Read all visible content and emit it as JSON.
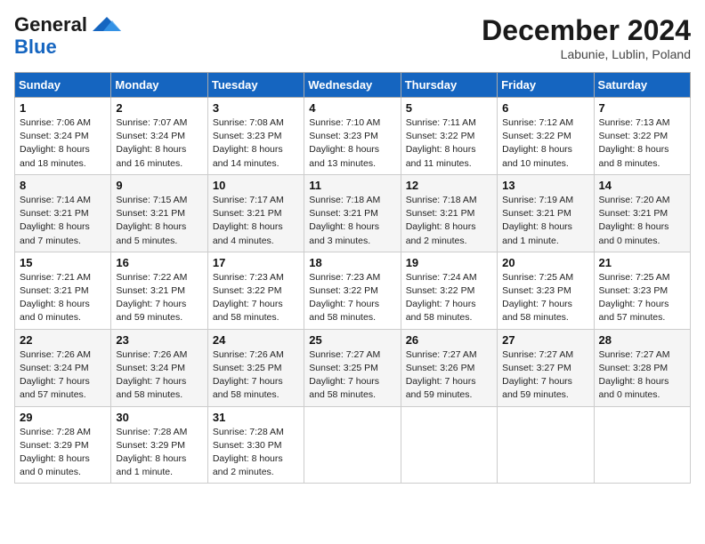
{
  "header": {
    "logo_line1": "General",
    "logo_line2": "Blue",
    "month_title": "December 2024",
    "location": "Labunie, Lublin, Poland"
  },
  "weekdays": [
    "Sunday",
    "Monday",
    "Tuesday",
    "Wednesday",
    "Thursday",
    "Friday",
    "Saturday"
  ],
  "weeks": [
    [
      {
        "day": 1,
        "sunrise": "7:06 AM",
        "sunset": "3:24 PM",
        "daylight": "8 hours and 18 minutes."
      },
      {
        "day": 2,
        "sunrise": "7:07 AM",
        "sunset": "3:24 PM",
        "daylight": "8 hours and 16 minutes."
      },
      {
        "day": 3,
        "sunrise": "7:08 AM",
        "sunset": "3:23 PM",
        "daylight": "8 hours and 14 minutes."
      },
      {
        "day": 4,
        "sunrise": "7:10 AM",
        "sunset": "3:23 PM",
        "daylight": "8 hours and 13 minutes."
      },
      {
        "day": 5,
        "sunrise": "7:11 AM",
        "sunset": "3:22 PM",
        "daylight": "8 hours and 11 minutes."
      },
      {
        "day": 6,
        "sunrise": "7:12 AM",
        "sunset": "3:22 PM",
        "daylight": "8 hours and 10 minutes."
      },
      {
        "day": 7,
        "sunrise": "7:13 AM",
        "sunset": "3:22 PM",
        "daylight": "8 hours and 8 minutes."
      }
    ],
    [
      {
        "day": 8,
        "sunrise": "7:14 AM",
        "sunset": "3:21 PM",
        "daylight": "8 hours and 7 minutes."
      },
      {
        "day": 9,
        "sunrise": "7:15 AM",
        "sunset": "3:21 PM",
        "daylight": "8 hours and 5 minutes."
      },
      {
        "day": 10,
        "sunrise": "7:17 AM",
        "sunset": "3:21 PM",
        "daylight": "8 hours and 4 minutes."
      },
      {
        "day": 11,
        "sunrise": "7:18 AM",
        "sunset": "3:21 PM",
        "daylight": "8 hours and 3 minutes."
      },
      {
        "day": 12,
        "sunrise": "7:18 AM",
        "sunset": "3:21 PM",
        "daylight": "8 hours and 2 minutes."
      },
      {
        "day": 13,
        "sunrise": "7:19 AM",
        "sunset": "3:21 PM",
        "daylight": "8 hours and 1 minute."
      },
      {
        "day": 14,
        "sunrise": "7:20 AM",
        "sunset": "3:21 PM",
        "daylight": "8 hours and 0 minutes."
      }
    ],
    [
      {
        "day": 15,
        "sunrise": "7:21 AM",
        "sunset": "3:21 PM",
        "daylight": "8 hours and 0 minutes."
      },
      {
        "day": 16,
        "sunrise": "7:22 AM",
        "sunset": "3:21 PM",
        "daylight": "7 hours and 59 minutes."
      },
      {
        "day": 17,
        "sunrise": "7:23 AM",
        "sunset": "3:22 PM",
        "daylight": "7 hours and 58 minutes."
      },
      {
        "day": 18,
        "sunrise": "7:23 AM",
        "sunset": "3:22 PM",
        "daylight": "7 hours and 58 minutes."
      },
      {
        "day": 19,
        "sunrise": "7:24 AM",
        "sunset": "3:22 PM",
        "daylight": "7 hours and 58 minutes."
      },
      {
        "day": 20,
        "sunrise": "7:25 AM",
        "sunset": "3:23 PM",
        "daylight": "7 hours and 58 minutes."
      },
      {
        "day": 21,
        "sunrise": "7:25 AM",
        "sunset": "3:23 PM",
        "daylight": "7 hours and 57 minutes."
      }
    ],
    [
      {
        "day": 22,
        "sunrise": "7:26 AM",
        "sunset": "3:24 PM",
        "daylight": "7 hours and 57 minutes."
      },
      {
        "day": 23,
        "sunrise": "7:26 AM",
        "sunset": "3:24 PM",
        "daylight": "7 hours and 58 minutes."
      },
      {
        "day": 24,
        "sunrise": "7:26 AM",
        "sunset": "3:25 PM",
        "daylight": "7 hours and 58 minutes."
      },
      {
        "day": 25,
        "sunrise": "7:27 AM",
        "sunset": "3:25 PM",
        "daylight": "7 hours and 58 minutes."
      },
      {
        "day": 26,
        "sunrise": "7:27 AM",
        "sunset": "3:26 PM",
        "daylight": "7 hours and 59 minutes."
      },
      {
        "day": 27,
        "sunrise": "7:27 AM",
        "sunset": "3:27 PM",
        "daylight": "7 hours and 59 minutes."
      },
      {
        "day": 28,
        "sunrise": "7:27 AM",
        "sunset": "3:28 PM",
        "daylight": "8 hours and 0 minutes."
      }
    ],
    [
      {
        "day": 29,
        "sunrise": "7:28 AM",
        "sunset": "3:29 PM",
        "daylight": "8 hours and 0 minutes."
      },
      {
        "day": 30,
        "sunrise": "7:28 AM",
        "sunset": "3:29 PM",
        "daylight": "8 hours and 1 minute."
      },
      {
        "day": 31,
        "sunrise": "7:28 AM",
        "sunset": "3:30 PM",
        "daylight": "8 hours and 2 minutes."
      },
      null,
      null,
      null,
      null
    ]
  ]
}
